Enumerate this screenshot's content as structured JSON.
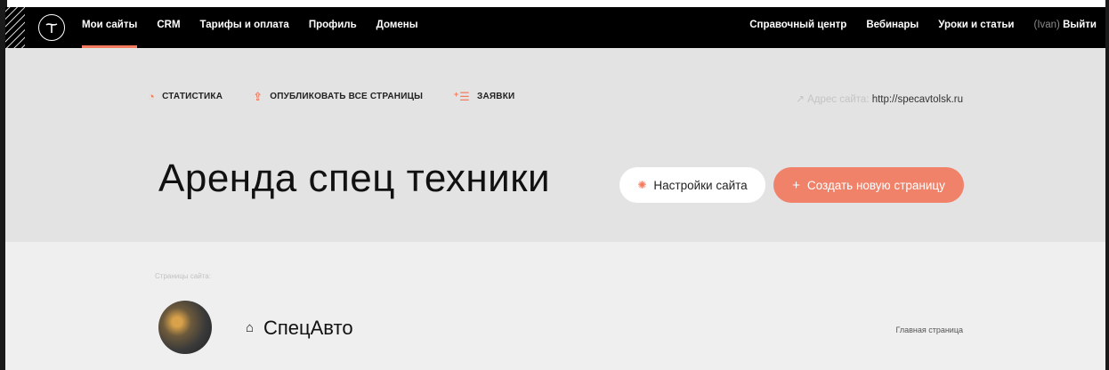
{
  "nav": {
    "left": [
      "Мои сайты",
      "CRM",
      "Тарифы и оплата",
      "Профиль",
      "Домены"
    ],
    "right": [
      "Справочный центр",
      "Вебинары",
      "Уроки и статьи"
    ],
    "user_name": "(Ivan)",
    "logout": "Выйти"
  },
  "toolbar": {
    "stats": "СТАТИСТИКА",
    "publish_all": "ОПУБЛИКОВАТЬ ВСЕ СТРАНИЦЫ",
    "requests": "ЗАЯВКИ"
  },
  "site": {
    "address_label": "Адрес сайта:",
    "address_url": "http://specavtolsk.ru",
    "title": "Аренда спец техники"
  },
  "buttons": {
    "settings": "Настройки сайта",
    "create_page": "Создать новую страницу"
  },
  "pages": {
    "caption": "Страницы сайта:",
    "items": [
      {
        "name": "СпецАвто",
        "tag": "Главная страница"
      }
    ]
  },
  "colors": {
    "accent": "#f47b5e",
    "topbar": "#000000"
  }
}
